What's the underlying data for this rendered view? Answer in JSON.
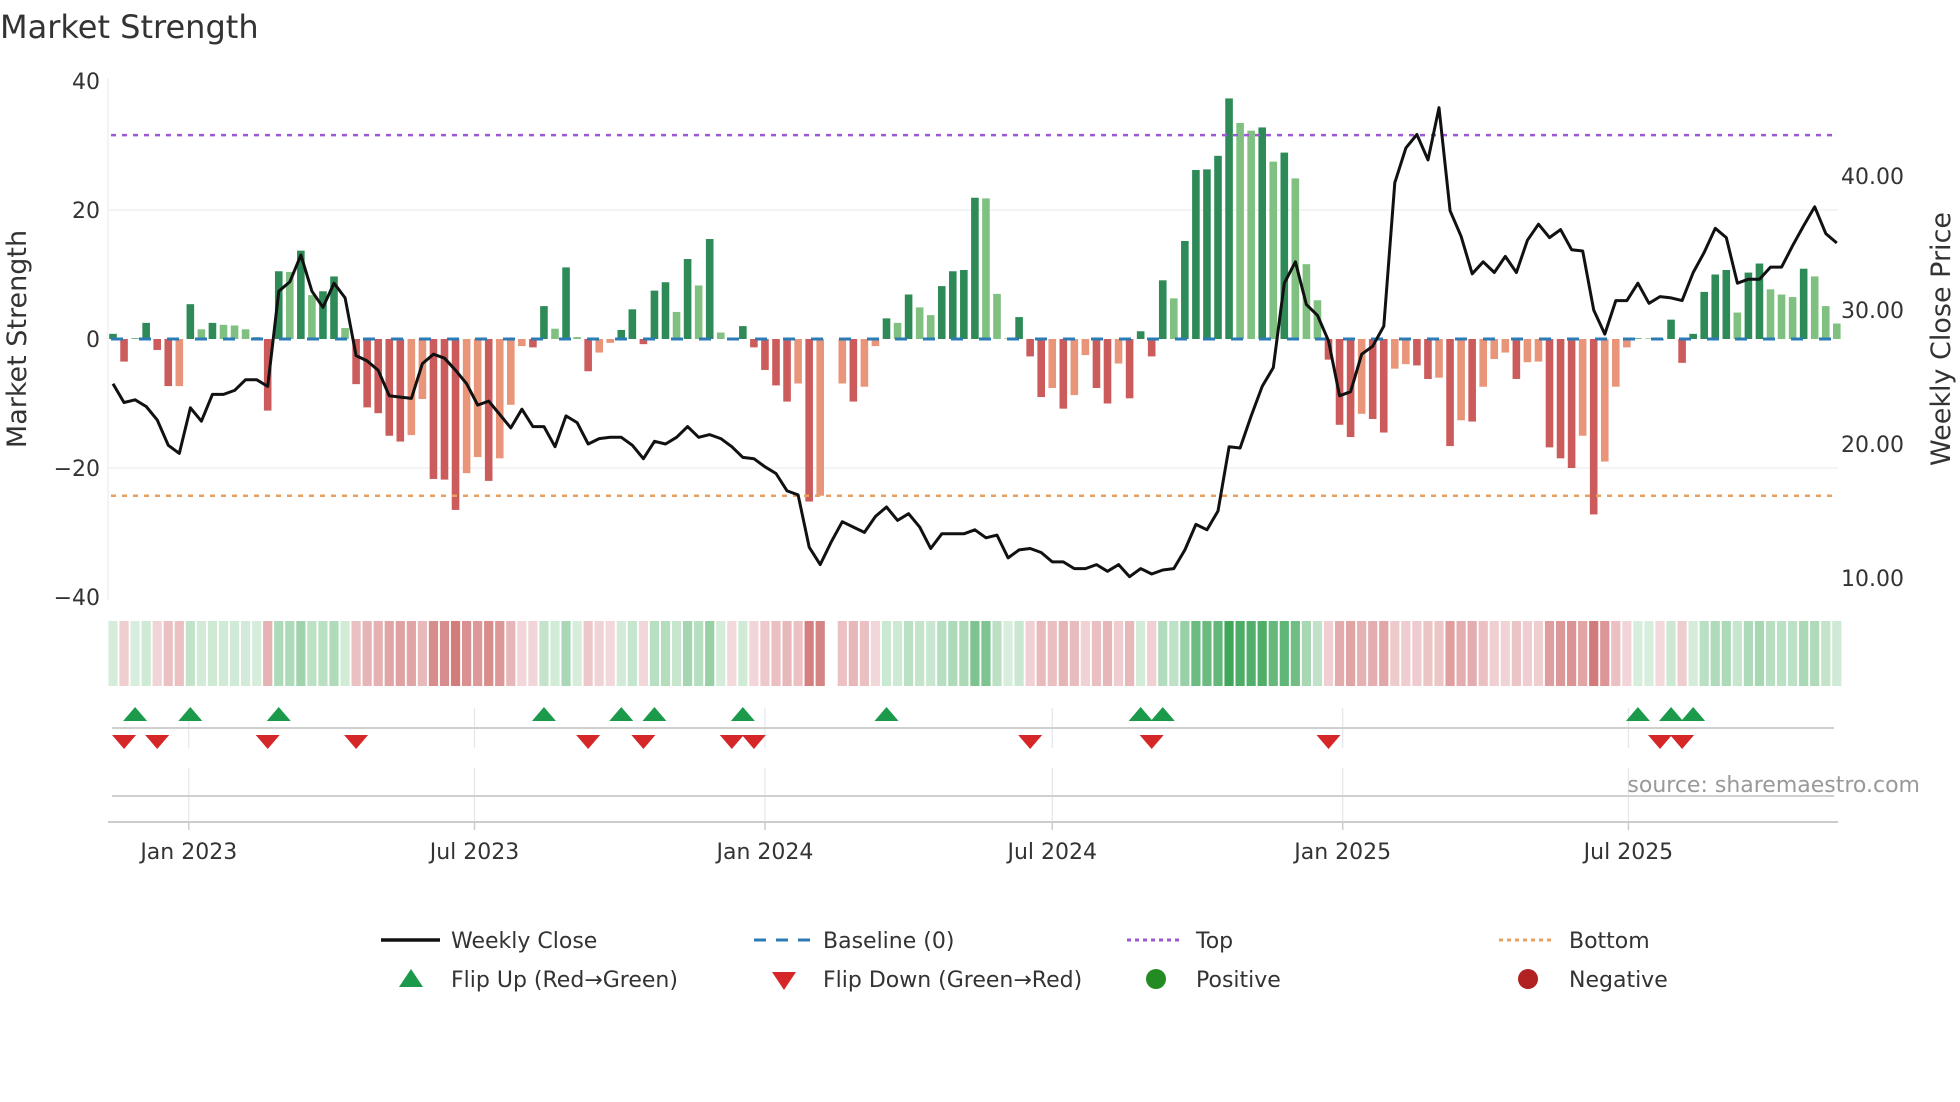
{
  "chart_data": {
    "type": "bar+line",
    "title": "Market Strength",
    "ylabel_left": "Market Strength",
    "ylabel_right": "Weekly Close Price",
    "source": "source: sharemaestro.com",
    "x_start": "2022-11-14",
    "x_step_days": 7,
    "ylim_left": [
      -40,
      40
    ],
    "yticks_left": [
      {
        "value": 40,
        "label": "40"
      },
      {
        "value": 20,
        "label": "20"
      },
      {
        "value": 0,
        "label": "0"
      },
      {
        "value": -20,
        "label": "−20"
      },
      {
        "value": -40,
        "label": "−40"
      }
    ],
    "yticks_right": [
      {
        "value": 40,
        "label": "40.00"
      },
      {
        "value": 30,
        "label": "30.00"
      },
      {
        "value": 20,
        "label": "20.00"
      },
      {
        "value": 10,
        "label": "10.00"
      }
    ],
    "xticks": [
      {
        "date": "2023-01-01",
        "label": "Jan 2023"
      },
      {
        "date": "2023-07-01",
        "label": "Jul 2023"
      },
      {
        "date": "2024-01-01",
        "label": "Jan 2024"
      },
      {
        "date": "2024-07-01",
        "label": "Jul 2024"
      },
      {
        "date": "2025-01-01",
        "label": "Jan 2025"
      },
      {
        "date": "2025-07-01",
        "label": "Jul 2025"
      }
    ],
    "top_level": 31.6,
    "bottom_level": -24.3,
    "baseline": 0,
    "strength": [
      0.8,
      -3.5,
      0.1,
      2.5,
      -1.7,
      -7.3,
      -7.3,
      5.4,
      1.5,
      2.5,
      2.2,
      2.1,
      1.5,
      0.3,
      -11.1,
      10.5,
      10.4,
      13.7,
      6.8,
      7.4,
      9.7,
      1.7,
      -7,
      -10.6,
      -11.5,
      -15,
      -15.9,
      -14.9,
      -9.3,
      -21.7,
      -21.8,
      -26.5,
      -20.8,
      -18.3,
      -22,
      -18.5,
      -10.2,
      -1.1,
      -1.3,
      5.1,
      1.6,
      11.1,
      0.3,
      -5,
      -2.1,
      -0.6,
      1.4,
      4.6,
      -0.8,
      7.5,
      8.8,
      4.2,
      12.4,
      8.3,
      15.5,
      1.0,
      -0.2,
      2.0,
      -1.3,
      -4.8,
      -7.2,
      -9.7,
      -6.9,
      -25.2,
      -24.3,
      null,
      -6.9,
      -9.7,
      -7.4,
      -1.1,
      3.2,
      2.5,
      6.9,
      4.9,
      3.7,
      8.2,
      10.5,
      10.7,
      21.9,
      21.8,
      7.0,
      0.1,
      3.4,
      -2.7,
      -9.0,
      -7.6,
      -10.8,
      -8.7,
      -2.5,
      -7.6,
      -10.0,
      -3.8,
      -9.2,
      1.2,
      -2.7,
      9.1,
      6.3,
      15.2,
      26.2,
      26.3,
      28.4,
      37.3,
      33.5,
      32.3,
      32.8,
      27.5,
      28.9,
      24.9,
      11.6,
      6.0,
      -3.2,
      -13.3,
      -15.2,
      -11.6,
      -12.4,
      -14.5,
      -4.6,
      -3.9,
      -4.1,
      -6.2,
      -6.0,
      -16.6,
      -12.6,
      -12.8,
      -7.4,
      -3.1,
      -2.1,
      -6.2,
      -3.6,
      -3.5,
      -16.8,
      -18.5,
      -20.0,
      -15.0,
      -27.2,
      -19.0,
      -7.4,
      -1.3,
      0.1,
      0.1,
      -0.2,
      3.0,
      -3.7,
      0.8,
      7.3,
      10.0,
      10.7,
      4.1,
      10.3,
      11.7,
      7.7,
      6.9,
      6.5,
      10.9,
      9.7,
      5.1,
      2.4
    ],
    "weekly_close": [
      24.5,
      23.1,
      23.3,
      22.8,
      21.8,
      19.9,
      19.3,
      22.7,
      21.7,
      23.7,
      23.7,
      24.0,
      24.8,
      24.8,
      24.3,
      31.4,
      32.1,
      34.1,
      31.4,
      30.2,
      32.0,
      30.9,
      26.6,
      26.2,
      25.5,
      23.6,
      23.5,
      23.4,
      26.0,
      26.7,
      26.4,
      25.5,
      24.5,
      22.9,
      23.2,
      22.2,
      21.2,
      22.6,
      21.3,
      21.3,
      19.8,
      22.1,
      21.6,
      20.0,
      20.4,
      20.5,
      20.5,
      19.9,
      18.9,
      20.2,
      20.0,
      20.5,
      21.3,
      20.5,
      20.7,
      20.4,
      19.8,
      19.0,
      18.9,
      18.3,
      17.8,
      16.5,
      16.2,
      12.3,
      11.0,
      12.7,
      14.2,
      13.8,
      13.4,
      14.6,
      15.3,
      14.3,
      14.8,
      13.8,
      12.2,
      13.3,
      13.3,
      13.3,
      13.6,
      13.0,
      13.2,
      11.5,
      12.1,
      12.2,
      11.9,
      11.2,
      11.2,
      10.7,
      10.7,
      11.0,
      10.5,
      11.0,
      10.1,
      10.7,
      10.3,
      10.6,
      10.7,
      12.1,
      14.0,
      13.6,
      15.0,
      19.8,
      19.7,
      22.1,
      24.3,
      25.7,
      32.0,
      33.6,
      30.4,
      29.6,
      27.7,
      23.6,
      23.9,
      26.7,
      27.3,
      28.8,
      39.5,
      42.1,
      43.1,
      41.2,
      45.1,
      37.4,
      35.5,
      32.7,
      33.6,
      32.8,
      34.0,
      32.8,
      35.2,
      36.4,
      35.4,
      36.0,
      34.5,
      34.4,
      30.0,
      28.2,
      30.7,
      30.7,
      32.0,
      30.5,
      31.0,
      30.9,
      30.7,
      32.8,
      34.3,
      36.1,
      35.4,
      32.0,
      32.3,
      32.3,
      33.2,
      33.2,
      34.8,
      36.3,
      37.7,
      35.7,
      35.0
    ],
    "flip_up_week_index": [
      2,
      7,
      15,
      39,
      46,
      49,
      57,
      70,
      93,
      95,
      138,
      141,
      143
    ],
    "flip_down_week_index": [
      1,
      4,
      14,
      22,
      43,
      48,
      56,
      58,
      83,
      94,
      110,
      140,
      142
    ],
    "legend": {
      "weekly_close": "Weekly Close",
      "baseline": "Baseline (0)",
      "top": "Top",
      "bottom": "Bottom",
      "flip_up": "Flip Up (Red→Green)",
      "flip_down": "Flip Down (Green→Red)",
      "positive": "Positive",
      "negative": "Negative"
    },
    "legend_placement": "bottom",
    "colors": {
      "rising_positive": "#2e8b57",
      "falling_positive": "#80c080",
      "falling_negative": "#cc5c5c",
      "rising_negative": "#e8957a",
      "line": "#111111",
      "baseline": "#2c7bb6",
      "top": "#9b59d6",
      "bottom": "#e8a060",
      "flip_up": "#1a9a4a",
      "flip_down": "#d62728",
      "positive": "#228b22",
      "negative": "#b22222"
    }
  }
}
